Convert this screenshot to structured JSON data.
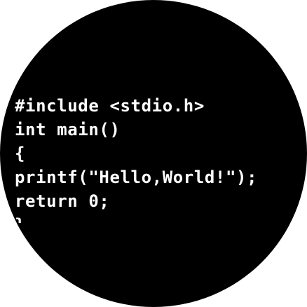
{
  "code": {
    "lines": [
      "#include <stdio.h>",
      "int main()",
      "{",
      "printf(\"Hello,World!\");",
      "return 0;",
      "}"
    ]
  },
  "colors": {
    "background": "#ffffff",
    "circle": "#000000",
    "text": "#ffffff"
  }
}
